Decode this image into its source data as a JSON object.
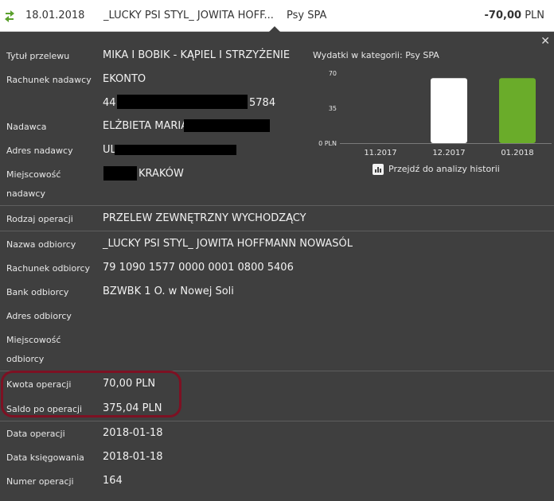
{
  "header": {
    "date": "18.01.2018",
    "payee": "_LUCKY PSI STYL_ JOWITA HOFF...",
    "category": "Psy SPA",
    "amount": "-70,00",
    "currency": "PLN"
  },
  "details": {
    "title_label": "Tytuł przelewu",
    "title_value": "MIKA I BOBIK - KĄPIEL I STRZYŻENIE",
    "sender_account_label": "Rachunek nadawcy",
    "sender_account_name": "EKONTO",
    "sender_account_prefix": "44",
    "sender_account_suffix": "5784",
    "sender_label": "Nadawca",
    "sender_value": "ELŻBIETA MARIA",
    "sender_address_label": "Adres nadawcy",
    "sender_address_value": "UL",
    "sender_city_label_1": "Miejscowość",
    "sender_city_label_2": "nadawcy",
    "sender_city_value": "KRAKÓW",
    "operation_type_label": "Rodzaj operacji",
    "operation_type_value": "PRZELEW ZEWNĘTRZNY WYCHODZĄCY",
    "recipient_name_label": "Nazwa odbiorcy",
    "recipient_name_value": "_LUCKY PSI STYL_ JOWITA HOFFMANN NOWASÓL",
    "recipient_account_label": "Rachunek odbiorcy",
    "recipient_account_value": "79 1090 1577 0000 0001 0800 5406",
    "recipient_bank_label": "Bank odbiorcy",
    "recipient_bank_value": "BZWBK 1 O. w Nowej Soli",
    "recipient_address_label": "Adres odbiorcy",
    "recipient_city_label_1": "Miejscowość",
    "recipient_city_label_2": "odbiorcy",
    "amount_label": "Kwota operacji",
    "amount_value": "70,00 PLN",
    "balance_label": "Saldo po operacji",
    "balance_value": "375,04 PLN",
    "operation_date_label": "Data operacji",
    "operation_date_value": "2018-01-18",
    "booking_date_label": "Data księgowania",
    "booking_date_value": "2018-01-18",
    "operation_number_label": "Numer operacji",
    "operation_number_value": "164"
  },
  "chart_panel": {
    "title": "Wydatki w kategorii:  Psy SPA",
    "history_link": "Przejdź do analizy historii"
  },
  "chart_data": {
    "type": "bar",
    "categories": [
      "11.2017",
      "12.2017",
      "01.2018"
    ],
    "values": [
      0,
      65,
      65
    ],
    "ylim": [
      0,
      70
    ],
    "yticks": [
      "0 PLN",
      "35",
      "70"
    ],
    "colors": [
      "#ffffff",
      "#ffffff",
      "#6aac2a"
    ]
  },
  "colors": {
    "background": "#3f3f3f",
    "highlight": "#7d1123",
    "accent_green": "#6aac2a"
  }
}
